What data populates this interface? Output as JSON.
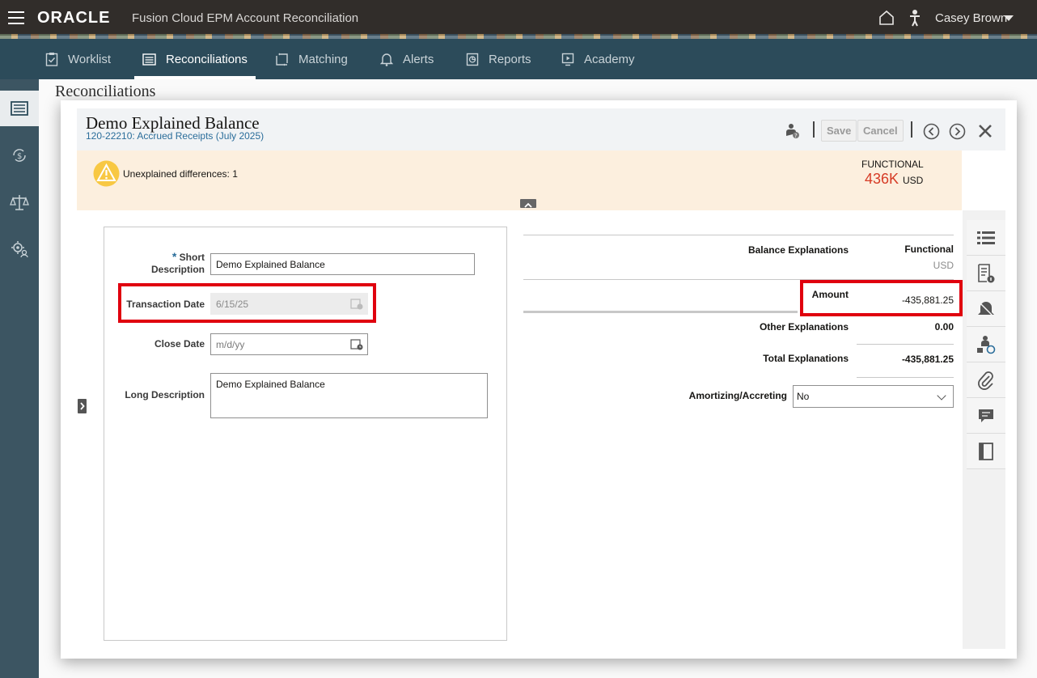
{
  "header": {
    "brand": "ORACLE",
    "app_name": "Fusion Cloud EPM Account Reconciliation",
    "user_name": "Casey Brown"
  },
  "nav": {
    "tabs": [
      {
        "label": "Worklist",
        "icon": "clipboard-check-icon"
      },
      {
        "label": "Reconciliations",
        "icon": "list-table-icon",
        "active": true
      },
      {
        "label": "Matching",
        "icon": "matching-icon"
      },
      {
        "label": "Alerts",
        "icon": "bell-icon"
      },
      {
        "label": "Reports",
        "icon": "report-icon"
      },
      {
        "label": "Academy",
        "icon": "video-play-icon"
      }
    ]
  },
  "page": {
    "title": "Reconciliations"
  },
  "dialog": {
    "title": "Demo Explained Balance",
    "subtitle": "120-22210: Accrued Receipts (July 2025)",
    "save_label": "Save",
    "cancel_label": "Cancel"
  },
  "banner": {
    "warning_text": "Unexplained differences: 1",
    "functional_label": "FUNCTIONAL",
    "functional_value": "436K",
    "functional_currency": "USD"
  },
  "form": {
    "short_description_label": "Short",
    "short_description_label2": "Description",
    "required_marker": "*",
    "short_description_value": "Demo Explained Balance",
    "transaction_date_label": "Transaction Date",
    "transaction_date_value": "6/15/25",
    "close_date_label": "Close Date",
    "close_date_placeholder": "m/d/yy",
    "long_description_label": "Long Description",
    "long_description_value": "Demo Explained Balance"
  },
  "summary": {
    "balance_explanations_label": "Balance Explanations",
    "functional_header": "Functional",
    "functional_currency": "USD",
    "amount_label": "Amount",
    "amount_value": "-435,881.25",
    "other_explanations_label": "Other Explanations",
    "other_explanations_value": "0.00",
    "total_explanations_label": "Total Explanations",
    "total_explanations_value": "-435,881.25",
    "amortizing_label": "Amortizing/Accreting",
    "amortizing_value": "No"
  },
  "colors": {
    "topbar": "#312d2a",
    "navbar": "#2c4b5a",
    "highlight": "#e0000e",
    "functional_value": "#d63b25",
    "banner": "#fcefde"
  }
}
